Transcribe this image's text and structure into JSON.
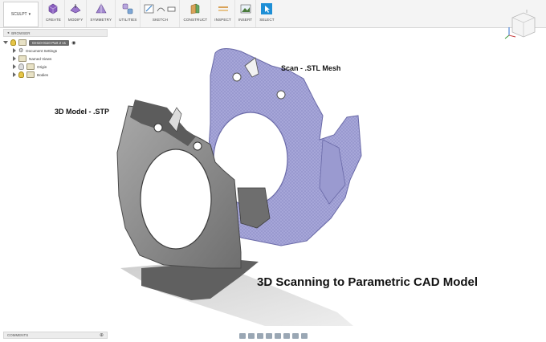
{
  "toolbar": {
    "workspace": "SCULPT",
    "groups": [
      {
        "label": "CREATE",
        "icon": "create-form-icon"
      },
      {
        "label": "MODIFY",
        "icon": "modify-icon"
      },
      {
        "label": "SYMMETRY",
        "icon": "symmetry-icon"
      },
      {
        "label": "UTILITIES",
        "icon": "utilities-icon"
      },
      {
        "label": "SKETCH",
        "icon": "sketch-icon"
      },
      {
        "label": "CONSTRUCT",
        "icon": "construct-icon"
      },
      {
        "label": "INSPECT",
        "icon": "inspect-icon"
      },
      {
        "label": "INSERT",
        "icon": "insert-icon"
      },
      {
        "label": "SELECT",
        "icon": "select-icon"
      }
    ]
  },
  "browser": {
    "title": "BROWSER",
    "document": "GH10-0110 Part 2 v1",
    "items": [
      "Document Settings",
      "Named Views",
      "Origin",
      "Bodies"
    ]
  },
  "canvas": {
    "scan_label": "Scan - .STL Mesh",
    "model_label": "3D Model - .STP",
    "caption": "3D Scanning to Parametric CAD Model"
  },
  "comments": {
    "title": "COMMENTS"
  },
  "colors": {
    "mesh": "#9c9ccf",
    "model": "#8d8d8d",
    "select_accent": "#1e8fd6"
  }
}
